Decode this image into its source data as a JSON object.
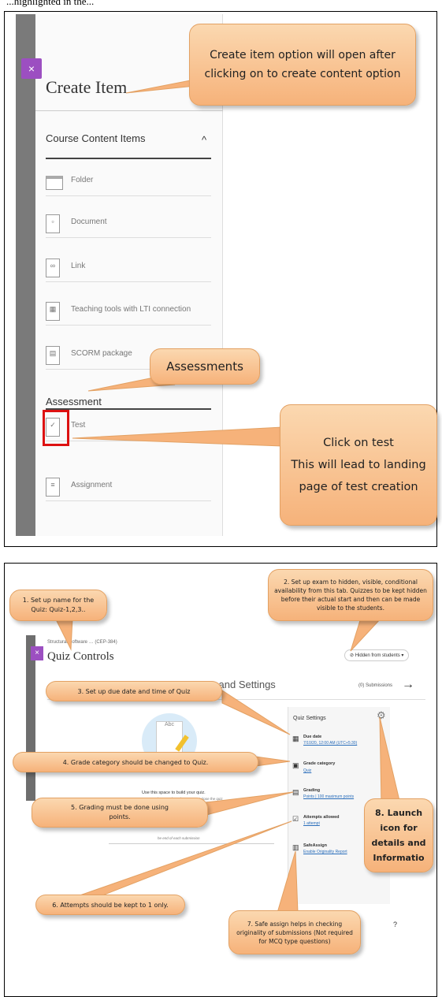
{
  "top_caption": "...highlighted in the...",
  "panel1": {
    "close_label": "×",
    "title": "Create Item",
    "section_content": "Course Content Items",
    "section_assessment": "Assessment",
    "collapse_chevron": "^",
    "items": [
      {
        "label": "Folder",
        "icon": "folder-icon"
      },
      {
        "label": "Document",
        "icon": "document-icon"
      },
      {
        "label": "Link",
        "icon": "link-icon"
      },
      {
        "label": "Teaching tools with LTI connection",
        "icon": "lti-icon"
      },
      {
        "label": "SCORM package",
        "icon": "scorm-icon"
      },
      {
        "label": "Test",
        "icon": "test-icon"
      },
      {
        "label": "Assignment",
        "icon": "assignment-icon"
      }
    ],
    "callouts": {
      "create_item": "Create item option will open after\nclicking on to create content option",
      "assessments": "Assessments",
      "click_test": "Click on test\nThis will lead to landing\npage of test creation"
    },
    "highlight_color": "#dd1111",
    "accent_color": "#9c4fc1"
  },
  "panel2": {
    "close_label": "×",
    "breadcrumb": "Structural Software … (CEP-384)",
    "page_title": "Quiz Controls",
    "visibility_button": "Hidden from students",
    "tab_title": "ntent and Settings",
    "submissions": "(0) Submissions",
    "build_title": "Use this space to build your quiz.",
    "build_sub": "You can save your changes along the way. Just close the quiz when you're finished.",
    "end_text": "he end of each submission",
    "quiz_settings": {
      "title": "Quiz Settings",
      "items": [
        {
          "title": "Due date",
          "value": "7/10/20, 12:00 AM (UTC+5:30)",
          "icon": "calendar-icon"
        },
        {
          "title": "Grade category",
          "value": "Quiz",
          "icon": "grade-icon"
        },
        {
          "title": "Grading",
          "value": "Points | 100 maximum points",
          "icon": "grading-icon"
        },
        {
          "title": "Attempts allowed",
          "value": "1 attempt",
          "icon": "attempts-icon"
        },
        {
          "title": "SafeAssign",
          "value": "Enable Originality Report",
          "icon": "safeassign-icon"
        }
      ]
    },
    "callouts": {
      "c1": "1. Set up name for the\nQuiz: Quiz-1,2,3..",
      "c2": "2. Set up exam to hidden, visible, conditional availability from this tab. Quizzes to be kept hidden before their actual start and then can be made visible to the students.",
      "c3": "3. Set up due date and time of Quiz",
      "c4": "4. Grade category should be changed to Quiz.",
      "c5": "5. Grading must be done using\npoints.",
      "c6": "6. Attempts should be kept to 1 only.",
      "c7": "7. Safe assign helps in checking originality of submissions (Not required for MCQ type questions)",
      "c8": "8. Launch\nicon for\ndetails and\nInformatio"
    }
  }
}
